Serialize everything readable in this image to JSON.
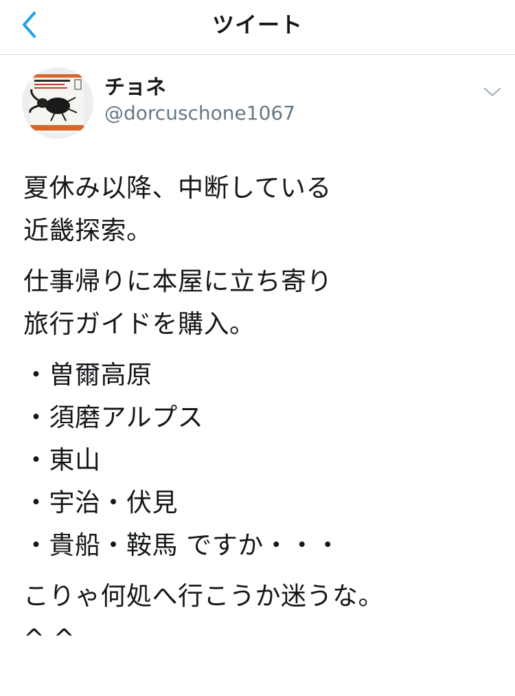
{
  "topbar": {
    "title": "ツイート"
  },
  "user": {
    "name": "チョネ",
    "handle": "@dorcuschone1067"
  },
  "tweet": {
    "paragraphs": [
      [
        "夏休み以降、中断している",
        "近畿探索。"
      ],
      [
        "仕事帰りに本屋に立ち寄り",
        "旅行ガイドを購入。"
      ],
      [
        "・曽爾高原",
        "・須磨アルプス",
        "・東山",
        "・宇治・伏見",
        "・貴船・鞍馬 ですか・・・"
      ],
      [
        "こりゃ何処へ行こうか迷うな。",
        "^ ^"
      ]
    ]
  },
  "colors": {
    "accent": "#1da1f2",
    "text": "#14171a",
    "secondary": "#657786",
    "divider": "#d8dde2"
  },
  "icons": {
    "back": "chevron-left-icon",
    "more": "chevron-down-icon"
  }
}
